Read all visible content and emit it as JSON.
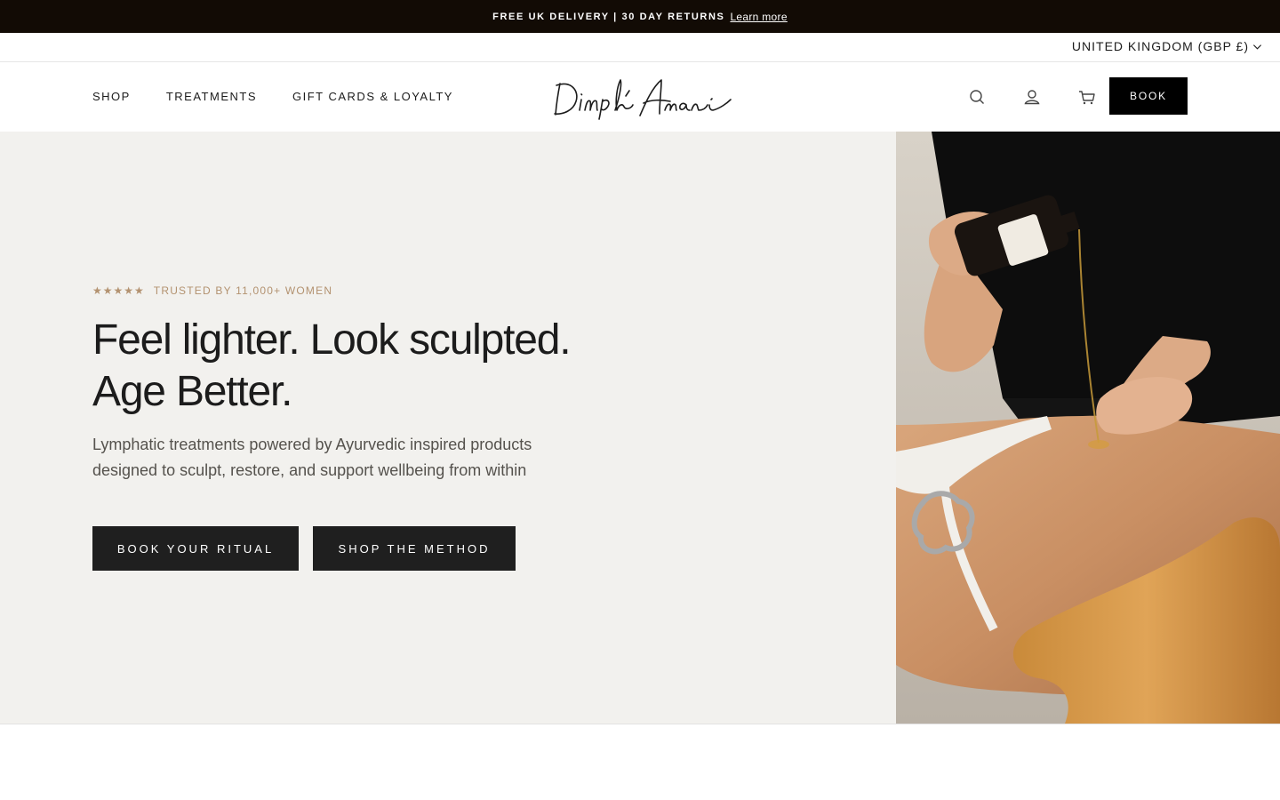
{
  "announcement": {
    "text": "FREE UK DELIVERY | 30 DAY RETURNS",
    "link": "Learn more"
  },
  "locale": {
    "label": "UNITED KINGDOM (GBP £)"
  },
  "header": {
    "nav": [
      "SHOP",
      "TREATMENTS",
      "GIFT CARDS & LOYALTY"
    ],
    "logo_text": "Dimple Amani",
    "icons": [
      "search-icon",
      "account-icon",
      "cart-icon"
    ],
    "book_label": "BOOK"
  },
  "hero": {
    "stars": "★★★★★",
    "rating": 5,
    "trusted": "TRUSTED BY 11,000+ WOMEN",
    "headline_line1": "Feel lighter. Look sculpted.",
    "headline_line2": "Age Better.",
    "sub_line1": "Lymphatic treatments powered by Ayurvedic inspired products",
    "sub_line2": "designed to sculpt, restore, and support wellbeing from within",
    "cta_book": "BOOK YOUR RITUAL",
    "cta_shop": "SHOP THE METHOD"
  },
  "colors": {
    "announcement_bg": "#120b05",
    "hero_bg": "#f2f1ee",
    "accent_gold": "#b39270",
    "button_dark": "#1f1f1f"
  }
}
